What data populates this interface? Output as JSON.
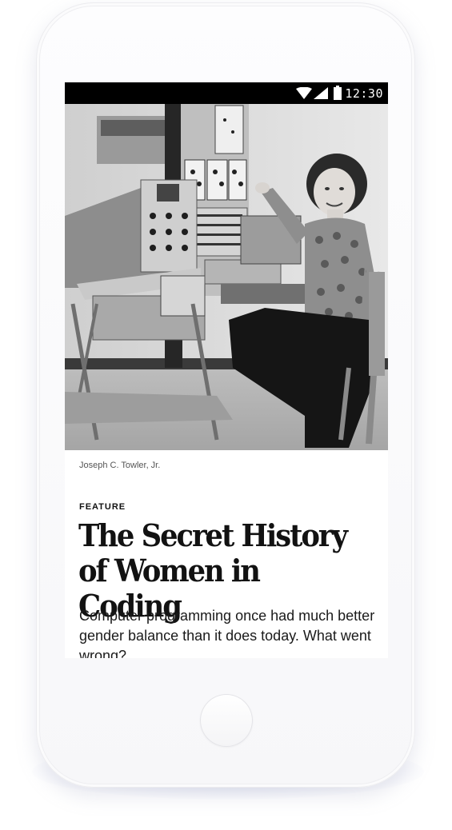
{
  "status_bar": {
    "time": "12:30",
    "icons": [
      "wifi-icon",
      "signal-icon",
      "battery-icon"
    ]
  },
  "article": {
    "photo_credit": "Joseph C. Towler, Jr.",
    "kicker": "FEATURE",
    "headline_line1": "The Secret History",
    "headline_line2": "of Women in Coding",
    "dek": "Computer programming once had much better gender balance than it does today. What went wrong?"
  },
  "colors": {
    "status_bar_bg": "#000000",
    "text": "#121212"
  }
}
